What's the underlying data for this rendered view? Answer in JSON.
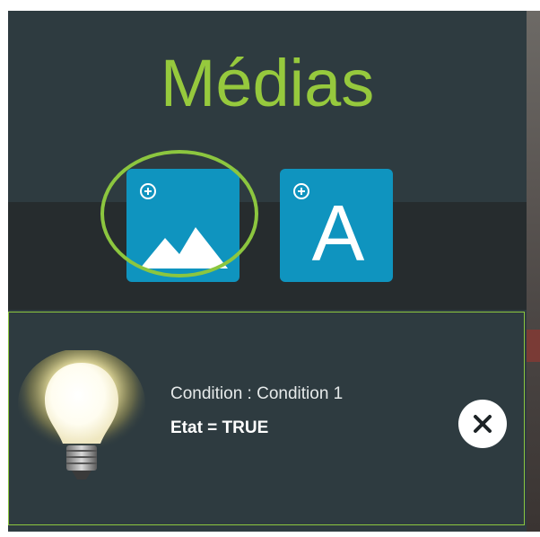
{
  "panel": {
    "title": "Médias"
  },
  "media_buttons": [
    {
      "name": "add-image",
      "icon": "mountain-icon",
      "badge_icon": "plus-circle-icon",
      "selected": true
    },
    {
      "name": "add-text",
      "icon": "letter-a-icon",
      "glyph": "A",
      "badge_icon": "plus-circle-icon",
      "selected": false
    }
  ],
  "condition": {
    "label": "Condition : Condition 1",
    "state": "Etat = TRUE",
    "icon": "lightbulb-icon",
    "remove_icon": "close-icon"
  },
  "colors": {
    "accent_green": "#8cc63f",
    "title_green": "#96c93d",
    "button_blue": "#0f94bf",
    "panel_bg": "#2e3b40"
  }
}
